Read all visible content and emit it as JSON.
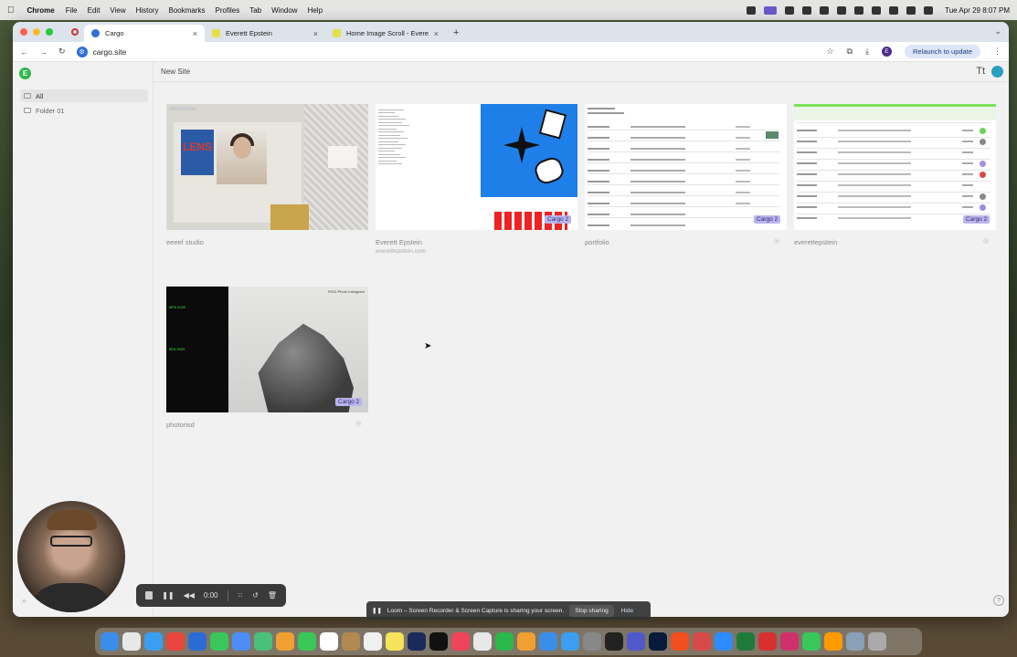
{
  "menubar": {
    "app": "Chrome",
    "items": [
      "File",
      "Edit",
      "View",
      "History",
      "Bookmarks",
      "Profiles",
      "Tab",
      "Window",
      "Help"
    ],
    "clock": "Tue Apr 29  8:07 PM"
  },
  "tabs": [
    {
      "title": "Cargo",
      "active": true
    },
    {
      "title": "Everett Epstein",
      "active": false
    },
    {
      "title": "Home Image Scroll - Everett E",
      "active": false
    }
  ],
  "toolbar": {
    "url": "cargo.site",
    "profile_initial": "E",
    "relaunch_label": "Relaunch to update"
  },
  "sidebar": {
    "logo_initial": "E",
    "folders": [
      {
        "label": "All",
        "selected": true
      },
      {
        "label": "Folder 01",
        "selected": false
      }
    ]
  },
  "main": {
    "new_site_label": "New Site",
    "typography_icon": "Tt",
    "sites": [
      {
        "name": "eeeef studio",
        "url": "",
        "badge": ""
      },
      {
        "name": "Everett Epstein",
        "url": "everettepstein.com",
        "badge": "Cargo 2"
      },
      {
        "name": "portfolio",
        "url": "",
        "badge": "Cargo 2"
      },
      {
        "name": "everettepstein",
        "url": "",
        "badge": "Cargo 2"
      },
      {
        "name": "photorisd",
        "url": "",
        "badge": "Cargo 2"
      }
    ],
    "thumb_texts": {
      "lens": "LENS",
      "photo_header": "RISD Photo  Instagram",
      "year_a": "MFA 2020",
      "year_b": "BFA 2020"
    }
  },
  "recorder": {
    "time": "0:00"
  },
  "loom_banner": {
    "message": "Loom – Screen Recorder & Screen Capture is sharing your screen.",
    "stop_label": "Stop sharing",
    "hide_label": "Hide"
  },
  "icons": {
    "help": "?"
  }
}
